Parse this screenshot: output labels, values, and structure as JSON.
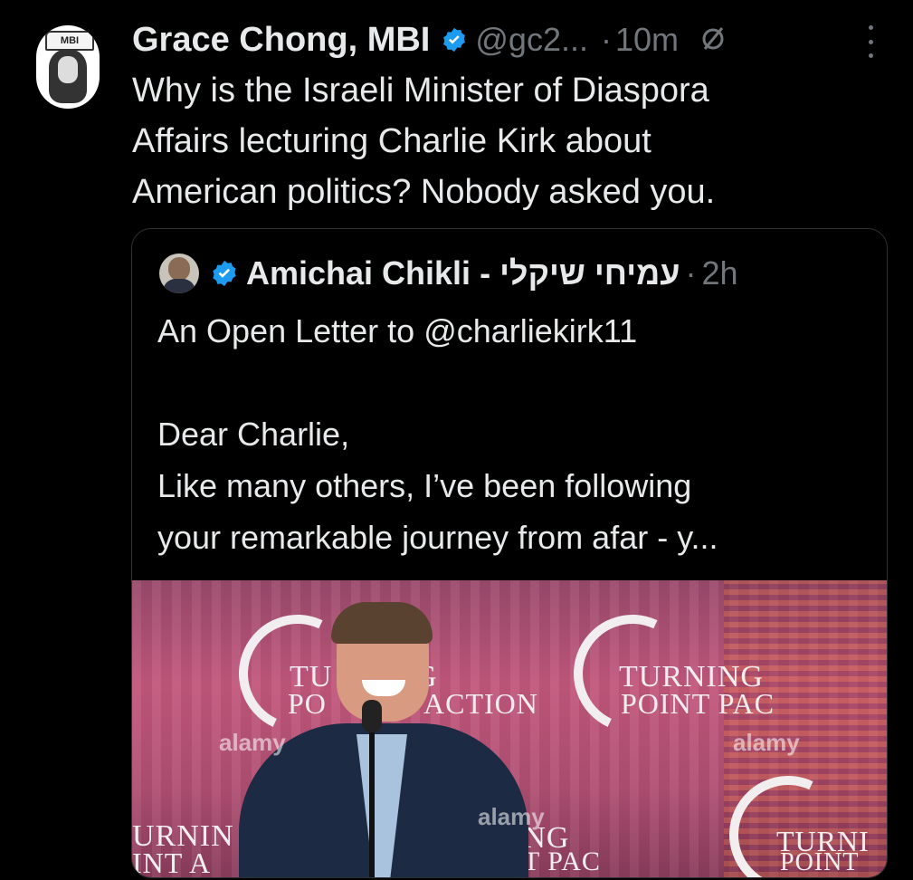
{
  "post": {
    "author_name": "Grace Chong, MBI",
    "handle": "@gc2...",
    "separator": "·",
    "time": "10m",
    "avatar_label": "MBI",
    "text_lines": [
      "Why is the Israeli Minister of Diaspora",
      "Affairs lecturing Charlie Kirk about",
      "American politics? Nobody asked you."
    ]
  },
  "quote": {
    "author_name": "Amichai Chikli - עמיחי שיקלי",
    "separator": "·",
    "time": "2h",
    "text_lines": [
      "An Open Letter to @charliekirk11",
      "",
      "Dear Charlie,",
      "Like many others, I’ve been following",
      "your remarkable journey from afar - y..."
    ],
    "media": {
      "logo_left": [
        "TU",
        "G",
        "PO",
        "ACTION"
      ],
      "logo_center": [
        "TURNING",
        "POINT PAC"
      ],
      "logo_bottom_left": [
        "URNIN",
        "INT A"
      ],
      "logo_bottom_mid": [
        "ING",
        "T PAC"
      ],
      "logo_bottom_right": [
        "TURNI",
        "POINT"
      ],
      "watermarks": [
        "alamy",
        "alamy",
        "alamy"
      ]
    }
  },
  "colors": {
    "background": "#000000",
    "text": "#e7e9ea",
    "muted": "#71767b",
    "verified": "#1d9bf0",
    "border": "#2f3336"
  },
  "icons": {
    "verified": "verified-badge-icon",
    "grok": "circle-slash-icon",
    "more": "more-icon"
  }
}
